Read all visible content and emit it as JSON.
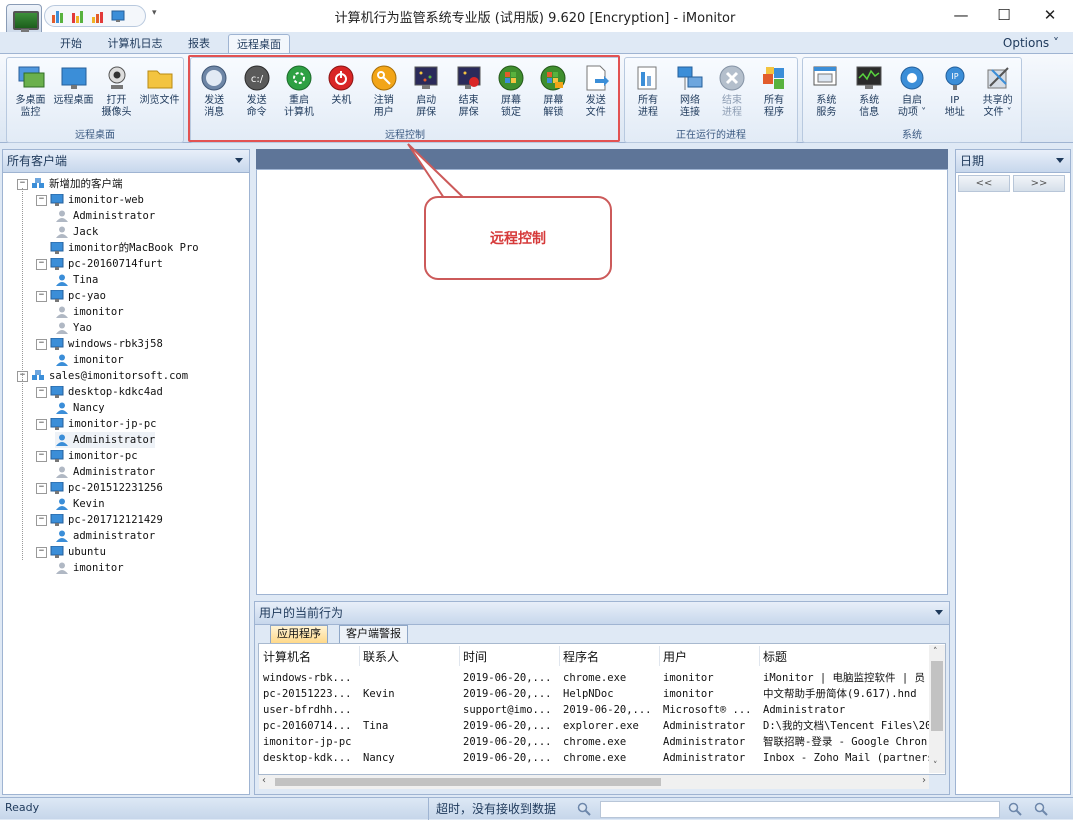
{
  "window": {
    "title": "计算机行为监管系统专业版 (试用版) 9.620 [Encryption] - iMonitor",
    "minimize": "—",
    "maximize": "☐",
    "close": "✕"
  },
  "tabs": [
    {
      "label": "开始"
    },
    {
      "label": "计算机日志"
    },
    {
      "label": "报表"
    },
    {
      "label": "远程桌面",
      "active": true
    }
  ],
  "options_label": "Options ˅",
  "ribbon": {
    "groups": [
      {
        "label": "远程桌面",
        "buttons": [
          {
            "label": "多桌面\n监控",
            "icon": "multi-desktop-icon"
          },
          {
            "label": "远程桌面",
            "icon": "remote-desktop-icon"
          },
          {
            "label": "打开\n摄像头",
            "icon": "webcam-icon"
          },
          {
            "label": "浏览文件",
            "icon": "folder-icon"
          }
        ]
      },
      {
        "label": "远程控制",
        "buttons": [
          {
            "label": "发送\n消息",
            "icon": "message-icon"
          },
          {
            "label": "发送\n命令",
            "icon": "command-icon"
          },
          {
            "label": "重启\n计算机",
            "icon": "restart-icon"
          },
          {
            "label": "关机",
            "icon": "shutdown-icon"
          },
          {
            "label": "注销\n用户",
            "icon": "logoff-icon"
          },
          {
            "label": "启动\n屏保",
            "icon": "start-screensaver-icon"
          },
          {
            "label": "结束\n屏保",
            "icon": "stop-screensaver-icon"
          },
          {
            "label": "屏幕\n锁定",
            "icon": "lock-screen-icon"
          },
          {
            "label": "屏幕\n解锁",
            "icon": "unlock-screen-icon"
          },
          {
            "label": "发送\n文件",
            "icon": "send-file-icon"
          }
        ]
      },
      {
        "label": "正在运行的进程",
        "buttons": [
          {
            "label": "所有\n进程",
            "icon": "processes-icon"
          },
          {
            "label": "网络\n连接",
            "icon": "network-icon"
          },
          {
            "label": "结束\n进程",
            "icon": "end-process-icon",
            "disabled": true
          },
          {
            "label": "所有\n程序",
            "icon": "programs-icon"
          }
        ]
      },
      {
        "label": "系统",
        "buttons": [
          {
            "label": "系统\n服务",
            "icon": "services-icon"
          },
          {
            "label": "系统\n信息",
            "icon": "system-info-icon"
          },
          {
            "label": "自启\n动项 ˅",
            "icon": "startup-icon"
          },
          {
            "label": "IP\n地址",
            "icon": "ip-icon"
          },
          {
            "label": "共享的\n文件 ˅",
            "icon": "shared-files-icon"
          }
        ]
      }
    ]
  },
  "left_panel": {
    "title": "所有客户端",
    "tree": [
      {
        "level": 0,
        "label": "新增加的客户端",
        "type": "group"
      },
      {
        "level": 1,
        "label": "imonitor-web",
        "type": "computer"
      },
      {
        "level": 2,
        "label": "Administrator",
        "type": "user-gray"
      },
      {
        "level": 2,
        "label": "Jack",
        "type": "user-gray"
      },
      {
        "level": 1,
        "label": "imonitor的MacBook Pro",
        "type": "computer",
        "no_toggle": true
      },
      {
        "level": 1,
        "label": "pc-20160714furt",
        "type": "computer"
      },
      {
        "level": 2,
        "label": "Tina",
        "type": "user"
      },
      {
        "level": 1,
        "label": "pc-yao",
        "type": "computer"
      },
      {
        "level": 2,
        "label": "imonitor",
        "type": "user-gray"
      },
      {
        "level": 2,
        "label": "Yao",
        "type": "user-gray"
      },
      {
        "level": 1,
        "label": "windows-rbk3j58",
        "type": "computer"
      },
      {
        "level": 2,
        "label": "imonitor",
        "type": "user"
      },
      {
        "level": 0,
        "label": "sales@imonitorsoft.com",
        "type": "group"
      },
      {
        "level": 1,
        "label": "desktop-kdkc4ad",
        "type": "computer"
      },
      {
        "level": 2,
        "label": "Nancy",
        "type": "user"
      },
      {
        "level": 1,
        "label": "imonitor-jp-pc",
        "type": "computer"
      },
      {
        "level": 2,
        "label": "Administrator",
        "type": "user",
        "selected": true
      },
      {
        "level": 1,
        "label": "imonitor-pc",
        "type": "computer"
      },
      {
        "level": 2,
        "label": "Administrator",
        "type": "user-gray"
      },
      {
        "level": 1,
        "label": "pc-201512231256",
        "type": "computer"
      },
      {
        "level": 2,
        "label": "Kevin",
        "type": "user"
      },
      {
        "level": 1,
        "label": "pc-201712121429",
        "type": "computer"
      },
      {
        "level": 2,
        "label": "administrator",
        "type": "user"
      },
      {
        "level": 1,
        "label": "ubuntu",
        "type": "computer"
      },
      {
        "level": 2,
        "label": "imonitor",
        "type": "user-gray"
      }
    ]
  },
  "callout": {
    "text": "远程控制"
  },
  "right_panel": {
    "title": "日期",
    "prev": "<<",
    "next": ">>"
  },
  "bottom_panel": {
    "title": "用户的当前行为",
    "tabs": [
      {
        "label": "应用程序",
        "active": true
      },
      {
        "label": "客户端警报"
      }
    ],
    "columns": [
      "计算机名",
      "联系人",
      "时间",
      "程序名",
      "用户",
      "标题"
    ],
    "rows": [
      [
        "windows-rbk...",
        "",
        "2019-06-20,...",
        "chrome.exe",
        "imonitor",
        "iMonitor | 电脑监控软件 | 员"
      ],
      [
        "pc-20151223...",
        "Kevin",
        "2019-06-20,...",
        "HelpNDoc",
        "imonitor",
        "中文帮助手册简体(9.617).hnd"
      ],
      [
        "user-bfrdhh...",
        "",
        "support@imo...",
        "2019-06-20,...",
        "Microsoft® ...",
        "Administrator"
      ],
      [
        "pc-20160714...",
        "Tina",
        "2019-06-20,...",
        "explorer.exe",
        "Administrator",
        "D:\\我的文档\\Tencent Files\\20"
      ],
      [
        "imonitor-jp-pc",
        "",
        "2019-06-20,...",
        "chrome.exe",
        "Administrator",
        "智联招聘-登录 - Google Chron"
      ],
      [
        "desktop-kdk...",
        "Nancy",
        "2019-06-20,...",
        "chrome.exe",
        "Administrator",
        "Inbox - Zoho Mail (partnersh"
      ]
    ]
  },
  "status_bar": {
    "ready": "Ready",
    "message": "超时，没有接收到数据"
  },
  "colors": {
    "accent_red": "#e25252",
    "header_dark": "#5e7598",
    "ribbon_border": "#9fb4d2"
  }
}
